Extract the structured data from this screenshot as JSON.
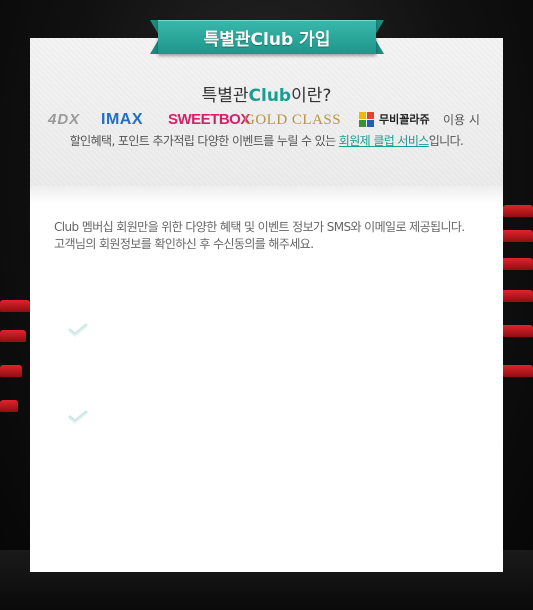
{
  "ribbon": {
    "title": "특별관Club 가입"
  },
  "about": {
    "title_prefix": "특별관",
    "title_club": "Club",
    "title_suffix": "이란?",
    "brands": {
      "fourdx": "4DX",
      "imax": "IMAX",
      "sweetbox": "SWEETBOX",
      "goldclass": "GOLD CLASS",
      "moviecollage": "무비꼴라쥬",
      "suffix": "이용 시"
    },
    "desc_prefix": "할인혜택, 포인트 추가적립 다양한 이벤트를 누릴 수 있는 ",
    "desc_link": "회원제 클럽 서비스",
    "desc_suffix": "입니다."
  },
  "notice": {
    "line1": "Club 멤버십 회원만을 위한 다양한 혜택 및 이벤트 정보가 SMS와 이메일로 제공됩니다.",
    "line2": "고객님의 회원정보를 확인하신 후 수신동의를 해주세요."
  },
  "colors": {
    "accent": "#1b9c90",
    "imax": "#1f6fc8",
    "sweetbox": "#d81f6a",
    "goldclass": "#b8953e"
  },
  "icons": {
    "check_sms": "check-icon",
    "check_email": "check-icon"
  }
}
